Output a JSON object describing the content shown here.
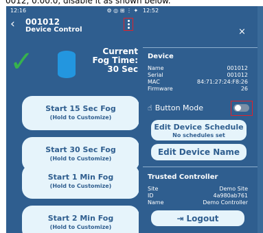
{
  "caption": "0012, 0.00.0, disable it as shown below.",
  "left": {
    "status_time": "12:16",
    "status_icons": "⚙ ◎ ⊞ ⋮ ✦ ᯤ ▮",
    "header": {
      "back_icon": "chevron-left-icon",
      "title": "001012",
      "subtitle": "Device Control",
      "menu_icon": "more-vertical-icon"
    },
    "fog_status": {
      "line1": "Current",
      "line2": "Fog Time:",
      "line3": "30 Sec",
      "help": "?"
    },
    "buttons": [
      {
        "label": "Start 15 Sec Fog",
        "hint": "(Hold to Customize)"
      },
      {
        "label": "Start 30 Sec Fog",
        "hint": "(Hold to Customize)"
      },
      {
        "label": "Start 1 Min Fog",
        "hint": "(Hold to Customize)"
      },
      {
        "label": "Start 2 Min Fog",
        "hint": "(Hold to Customize)"
      }
    ]
  },
  "right": {
    "status_time": "12:52",
    "close": "×",
    "device": {
      "title": "Device",
      "rows": [
        {
          "key": "Name",
          "value": "001012"
        },
        {
          "key": "Serial",
          "value": "001012"
        },
        {
          "key": "MAC",
          "value": "84:71:27:24:F8:26"
        },
        {
          "key": "Firmware",
          "value": "26"
        }
      ],
      "button_mode_label": "Button Mode",
      "button_mode_on": false,
      "schedule_button": "Edit Device Schedule",
      "schedule_hint": "No schedules set",
      "name_button": "Edit Device Name"
    },
    "trusted": {
      "title": "Trusted Controller",
      "rows": [
        {
          "key": "Site",
          "value": "Demo Site"
        },
        {
          "key": "ID",
          "value": "4a980ab761"
        },
        {
          "key": "Name",
          "value": "Demo Controller"
        }
      ],
      "logout": "Logout"
    }
  },
  "colors": {
    "bg_blue": "#2f5e8f",
    "button_bg": "#e6f4fb",
    "highlight_red": "#e0212a",
    "check_green": "#37b24d",
    "tank_blue": "#2396df"
  }
}
